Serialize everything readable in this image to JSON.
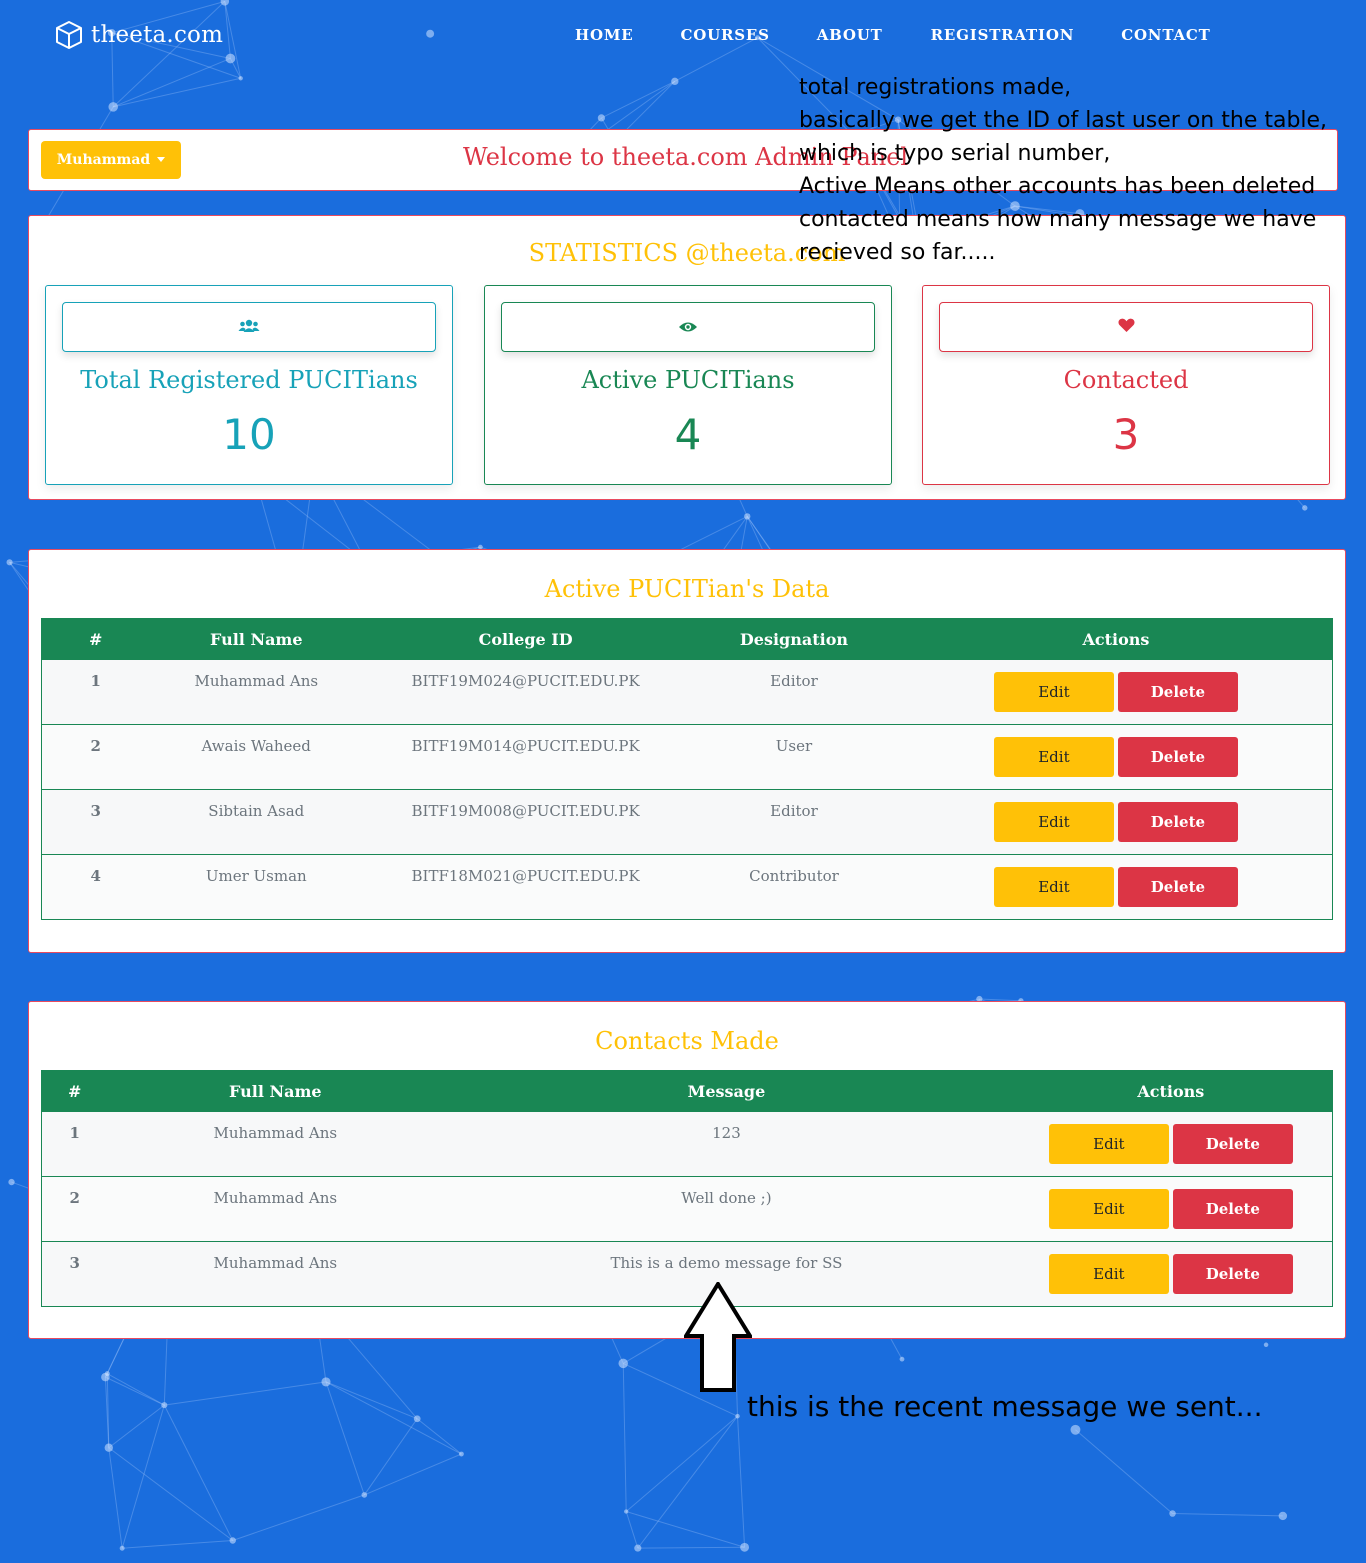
{
  "brand": {
    "name": "theeta.com",
    "icon": "cube-icon"
  },
  "nav": {
    "home": "HOME",
    "courses": "COURSES",
    "about": "ABOUT",
    "registration": "REGISTRATION",
    "contact": "CONTACT"
  },
  "welcome": {
    "user": "Muhammad",
    "title": "Welcome to theeta.com Admin Panel"
  },
  "annotation": {
    "lines": [
      "total registrations made,",
      "basically we get the ID of last user on the table,",
      "which is typo serial number,",
      "Active Means other accounts has been deleted",
      "contacted means how many message we have",
      "recieved so far....."
    ],
    "arrow_note": "this is the recent message we sent..."
  },
  "stats": {
    "title": "STATISTICS @theeta.com",
    "cards": [
      {
        "label": "Total Registered PUCITians",
        "value": "10",
        "icon": "users-icon",
        "color": "#17a2b8"
      },
      {
        "label": "Active PUCITians",
        "value": "4",
        "icon": "eye-icon",
        "color": "#198754"
      },
      {
        "label": "Contacted",
        "value": "3",
        "icon": "heart-icon",
        "color": "#dc3545"
      }
    ]
  },
  "users": {
    "title": "Active PUCITian's Data",
    "headers": {
      "num": "#",
      "name": "Full Name",
      "college_id": "College ID",
      "designation": "Designation",
      "actions": "Actions"
    },
    "rows": [
      {
        "num": "1",
        "name": "Muhammad Ans",
        "college_id": "BITF19M024@PUCIT.EDU.PK",
        "designation": "Editor"
      },
      {
        "num": "2",
        "name": "Awais Waheed",
        "college_id": "BITF19M014@PUCIT.EDU.PK",
        "designation": "User"
      },
      {
        "num": "3",
        "name": "Sibtain Asad",
        "college_id": "BITF19M008@PUCIT.EDU.PK",
        "designation": "Editor"
      },
      {
        "num": "4",
        "name": "Umer Usman",
        "college_id": "BITF18M021@PUCIT.EDU.PK",
        "designation": "Contributor"
      }
    ]
  },
  "contacts": {
    "title": "Contacts Made",
    "headers": {
      "num": "#",
      "name": "Full Name",
      "message": "Message",
      "actions": "Actions"
    },
    "rows": [
      {
        "num": "1",
        "name": "Muhammad Ans",
        "message": "123"
      },
      {
        "num": "2",
        "name": "Muhammad Ans",
        "message": "Well done ;)"
      },
      {
        "num": "3",
        "name": "Muhammad Ans",
        "message": "This is a demo message for SS"
      }
    ]
  },
  "buttons": {
    "edit": "Edit",
    "delete": "Delete"
  },
  "colors": {
    "background": "#1a6ddd",
    "accent_yellow": "#ffc107",
    "table_header": "#198754",
    "danger": "#dc3545",
    "info": "#17a2b8"
  }
}
